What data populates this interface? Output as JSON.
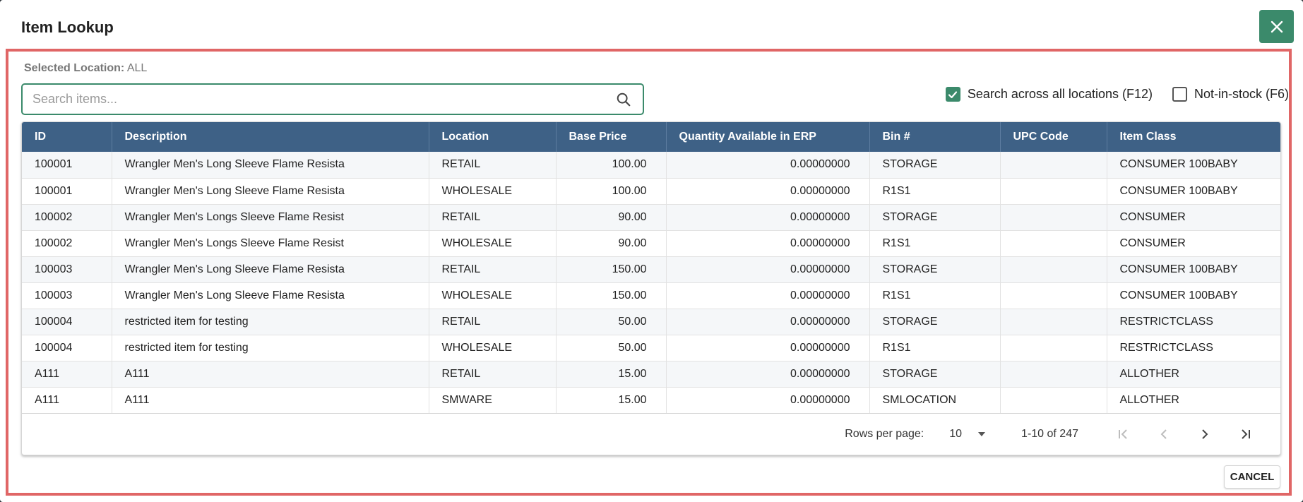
{
  "dialog": {
    "title": "Item Lookup",
    "selected_location_label": "Selected Location:",
    "selected_location_value": "ALL",
    "cancel_label": "CANCEL"
  },
  "search": {
    "placeholder": "Search items...",
    "value": ""
  },
  "options": [
    {
      "label": "Search across all locations (F12)",
      "checked": true
    },
    {
      "label": "Not-in-stock (F6)",
      "checked": false
    }
  ],
  "table": {
    "columns": [
      "ID",
      "Description",
      "Location",
      "Base Price",
      "Quantity Available in ERP",
      "Bin #",
      "UPC Code",
      "Item Class"
    ],
    "rows": [
      [
        "100001",
        "Wrangler Men's Long Sleeve Flame Resista",
        "RETAIL",
        "100.00",
        "0.00000000",
        "STORAGE",
        "",
        "CONSUMER 100BABY"
      ],
      [
        "100001",
        "Wrangler Men's Long Sleeve Flame Resista",
        "WHOLESALE",
        "100.00",
        "0.00000000",
        "R1S1",
        "",
        "CONSUMER 100BABY"
      ],
      [
        "100002",
        "Wrangler Men's Longs Sleeve Flame Resist",
        "RETAIL",
        "90.00",
        "0.00000000",
        "STORAGE",
        "",
        "CONSUMER"
      ],
      [
        "100002",
        "Wrangler Men's Longs Sleeve Flame Resist",
        "WHOLESALE",
        "90.00",
        "0.00000000",
        "R1S1",
        "",
        "CONSUMER"
      ],
      [
        "100003",
        "Wrangler Men's Long Sleeve Flame Resista",
        "RETAIL",
        "150.00",
        "0.00000000",
        "STORAGE",
        "",
        "CONSUMER 100BABY"
      ],
      [
        "100003",
        "Wrangler Men's Long Sleeve Flame Resista",
        "WHOLESALE",
        "150.00",
        "0.00000000",
        "R1S1",
        "",
        "CONSUMER 100BABY"
      ],
      [
        "100004",
        "restricted item for testing",
        "RETAIL",
        "50.00",
        "0.00000000",
        "STORAGE",
        "",
        "RESTRICTCLASS"
      ],
      [
        "100004",
        "restricted item for testing",
        "WHOLESALE",
        "50.00",
        "0.00000000",
        "R1S1",
        "",
        "RESTRICTCLASS"
      ],
      [
        "A111",
        "A111",
        "RETAIL",
        "15.00",
        "0.00000000",
        "STORAGE",
        "",
        "ALLOTHER"
      ],
      [
        "A111",
        "A111",
        "SMWARE",
        "15.00",
        "0.00000000",
        "SMLOCATION",
        "",
        "ALLOTHER"
      ]
    ]
  },
  "pagination": {
    "rows_per_page_label": "Rows per page:",
    "rows_per_page_value": "10",
    "range_label": "1-10 of 247"
  },
  "icons": {
    "close": "close-icon",
    "search": "search-icon",
    "checkbox_checked": "check-icon",
    "dropdown": "caret-down-icon",
    "first_page": "first-page-icon",
    "prev_page": "chevron-left-icon",
    "next_page": "chevron-right-icon",
    "last_page": "last-page-icon"
  },
  "colors": {
    "accent": "#3b8a6b",
    "header": "#3e6186",
    "frame_border": "#e06666"
  }
}
